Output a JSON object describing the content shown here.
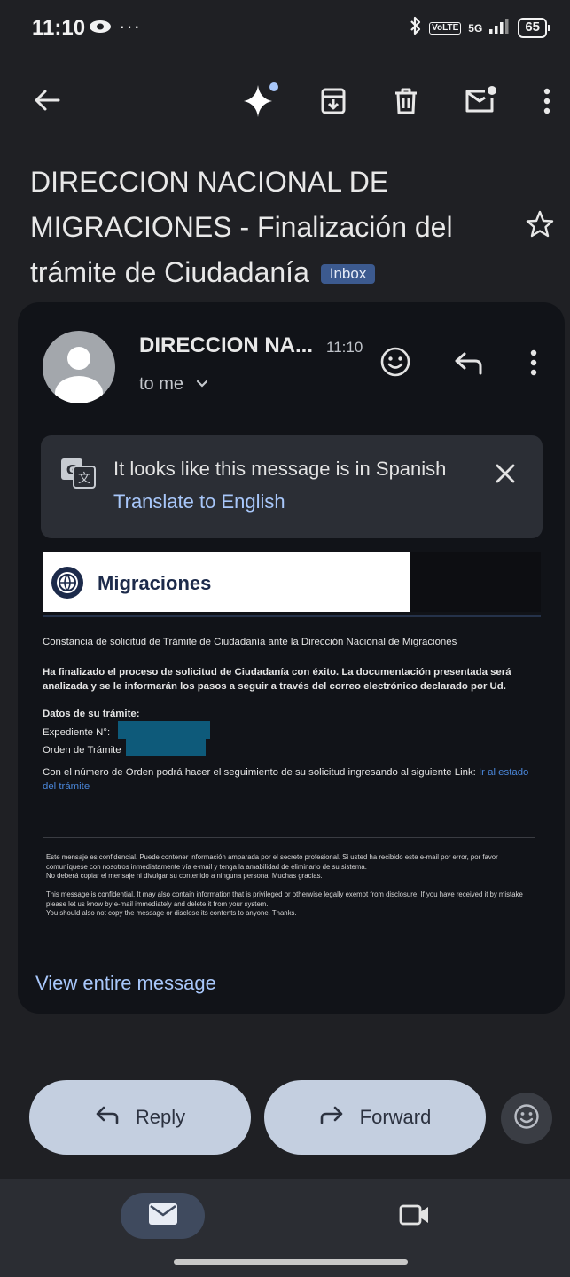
{
  "status_bar": {
    "time": "11:10",
    "dots": "···",
    "volte": "VoLTE",
    "network": "5G",
    "battery": "65"
  },
  "toolbar": {
    "icons": [
      "back-arrow-icon",
      "sparkle-icon",
      "archive-icon",
      "delete-icon",
      "mark-unread-icon",
      "more-vert-icon"
    ]
  },
  "email": {
    "subject": "DIRECCION NACIONAL DE MIGRACIONES - Finalización del trámite de Ciudadanía",
    "label": "Inbox",
    "sender": "DIRECCION NA...",
    "time": "11:10",
    "recipient": "to me"
  },
  "translate": {
    "message": "It looks like this message is in Spanish",
    "action": "Translate to English"
  },
  "body": {
    "logo_text": "Migraciones",
    "intro": "Constancia de solicitud de Trámite de Ciudadanía ante la Dirección Nacional de Migraciones",
    "bold_notice": "Ha finalizado el proceso de solicitud de Ciudadanía con éxito. La documentación presentada será analizada y se le informarán los pasos a seguir a través del correo electrónico declarado por Ud.",
    "data_heading": "Datos de su trámite:",
    "expediente_label": "Expediente N°:",
    "orden_label": "Orden de Trámite",
    "followup_text": "Con el número de Orden podrá hacer el seguimiento de su solicitud ingresando al siguiente Link:",
    "followup_link": "Ir al estado del trámite",
    "legal_es_1": "Este mensaje es confidencial. Puede contener información amparada por el secreto profesional. Si usted ha recibido este e-mail por error, por favor comuníquese con nosotros inmediatamente vía e-mail y tenga la amabilidad de eliminarlo de su sistema.",
    "legal_es_2": "No deberá copiar el mensaje ni divulgar su contenido a ninguna persona. Muchas gracias.",
    "legal_en_1": "This message is confidential. It may also contain information that is privileged or otherwise legally exempt from disclosure. If you have received it by mistake please let us know by e-mail immediately and delete it from your system.",
    "legal_en_2": "You should also not copy the message or disclose its contents to anyone. Thanks."
  },
  "view_entire": "View entire message",
  "actions": {
    "reply": "Reply",
    "forward": "Forward"
  },
  "colors": {
    "background": "#1f2024",
    "card": "#111318",
    "accent_link": "#a8c7fa",
    "pill": "#c4cfe0",
    "inbox_badge": "#3c5a8f",
    "redaction": "#0e5a7a"
  }
}
